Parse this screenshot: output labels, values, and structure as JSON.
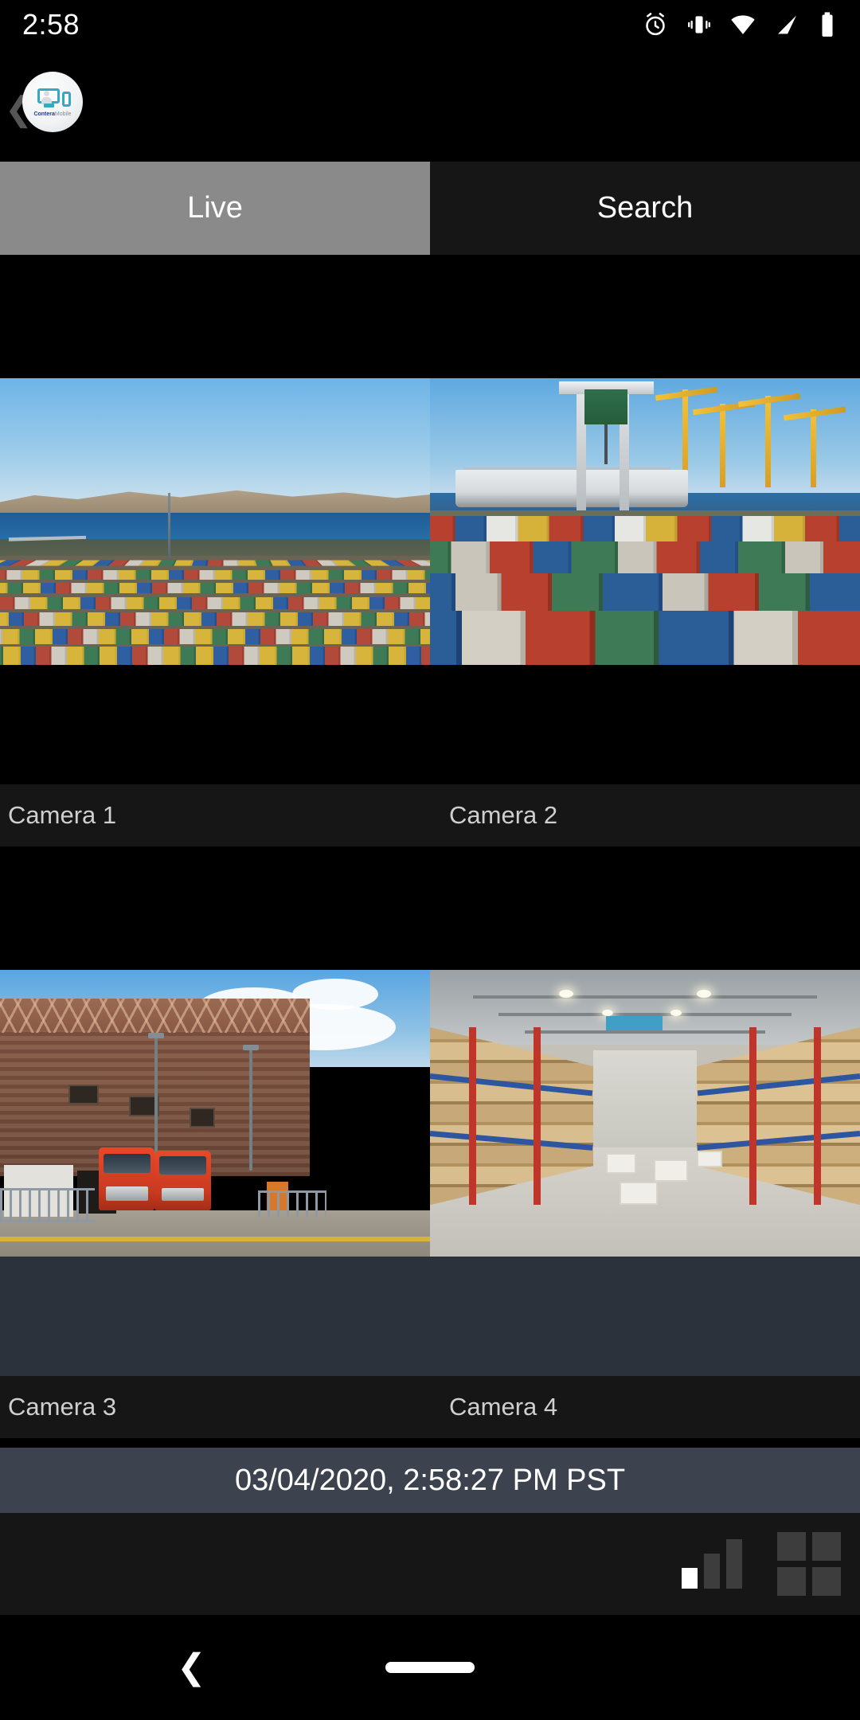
{
  "status_bar": {
    "time": "2:58",
    "icons": [
      "alarm-icon",
      "vibrate-icon",
      "wifi-icon",
      "cellular-signal-icon",
      "battery-icon"
    ]
  },
  "header": {
    "back_icon": "❮",
    "app_logo": {
      "icon": "contera-mobile-logo-icon",
      "brand_primary": "Contera",
      "brand_secondary": "Mobile"
    }
  },
  "tabs": [
    {
      "label": "Live",
      "active": true
    },
    {
      "label": "Search",
      "active": false
    }
  ],
  "cameras": [
    {
      "label": "Camera 1",
      "scene": "port-container-yard-sea"
    },
    {
      "label": "Camera 2",
      "scene": "gantry-crane-container-stacks"
    },
    {
      "label": "Camera 3",
      "scene": "warehouse-exterior-red-trucks"
    },
    {
      "label": "Camera 4",
      "scene": "warehouse-interior-aisle"
    }
  ],
  "timestamp": "03/04/2020, 2:58:27 PM PST",
  "toolbar": {
    "quality_icon": "signal-bars-icon",
    "quality_level": 1,
    "quality_levels_total": 3,
    "layout_icon": "grid-2x2-layout-icon"
  },
  "nav_bar": {
    "back_icon": "❮",
    "home_icon": "home-pill-icon"
  },
  "colors": {
    "tab_active_bg": "#8a8a8a",
    "tab_inactive_bg": "#161616",
    "timestamp_bar_bg": "#3c434e",
    "label_band_bg": "#161616",
    "label_text": "#cfcfcf",
    "brand_accent": "#35a8c4",
    "quality_active": "#ffffff",
    "icon_inactive": "#3d3d3d"
  }
}
